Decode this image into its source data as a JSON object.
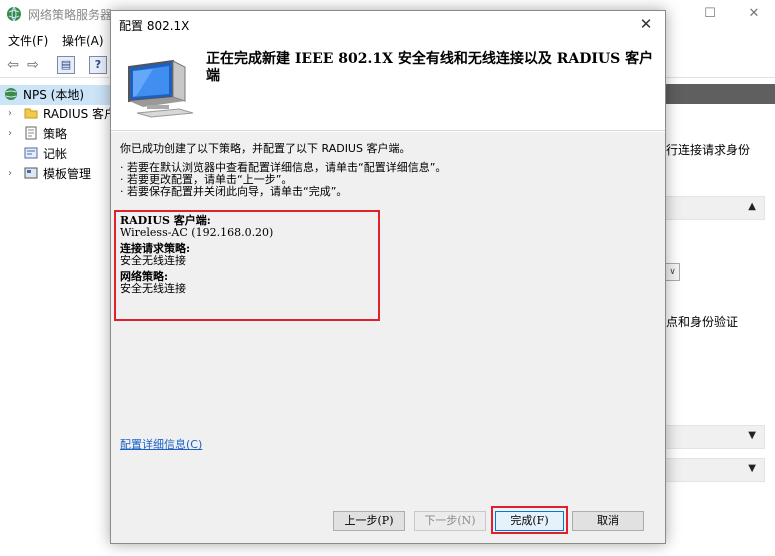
{
  "app": {
    "title": "网络策略服务器",
    "window_buttons": {
      "minimize": "─",
      "maximize": "☐",
      "close": "✕"
    },
    "menu": [
      "文件(F)",
      "操作(A)"
    ]
  },
  "tree": {
    "root": "NPS (本地)",
    "items": [
      {
        "label": "RADIUS 客户"
      },
      {
        "label": "策略"
      },
      {
        "label": "记帐"
      },
      {
        "label": "模板管理"
      }
    ]
  },
  "right_panel": {
    "text1": "行连接请求身份",
    "text2": "点和身份验证",
    "arrow_up": "▲",
    "arrow_down": "▼",
    "dropdown_chevron": "∨"
  },
  "dialog": {
    "title": "配置 802.1X",
    "close": "✕",
    "header_title": "正在完成新建 IEEE 802.1X 安全有线和无线连接以及 RADIUS 客户端",
    "intro": "你已成功创建了以下策略，并配置了以下 RADIUS 客户端。",
    "bullets": [
      "· 若要在默认浏览器中查看配置详细信息，请单击“配置详细信息”。",
      "· 若要更改配置，请单击“上一步”。",
      "· 若要保存配置并关闭此向导，请单击“完成”。"
    ],
    "summary": {
      "radius_client_heading": "RADIUS 客户端:",
      "radius_client_value": "Wireless-AC (192.168.0.20)",
      "crp_heading": "连接请求策略:",
      "crp_value": "安全无线连接",
      "np_heading": "网络策略:",
      "np_value": "安全无线连接"
    },
    "details_link": "配置详细信息(C)",
    "buttons": {
      "back": "上一步(P)",
      "next": "下一步(N)",
      "finish": "完成(F)",
      "cancel": "取消"
    }
  },
  "colors": {
    "highlight_red": "#e0202a",
    "link_blue": "#1a60c8",
    "dark_header": "#5f5f5f"
  }
}
